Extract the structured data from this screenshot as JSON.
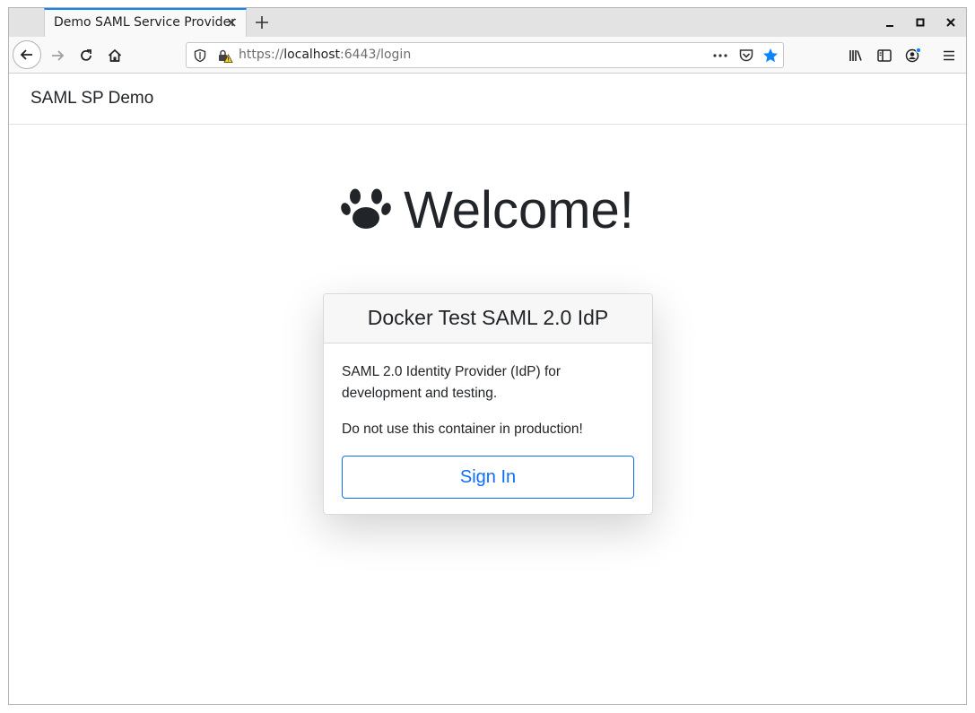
{
  "browser": {
    "tab_title": "Demo SAML Service Provider",
    "url_prefix": "https://",
    "url_host": "localhost",
    "url_rest": ":6443/login",
    "accent_color": "#0a84ff"
  },
  "site": {
    "brand": "SAML SP Demo",
    "heading": "Welcome!",
    "heading_icon": "paw-icon"
  },
  "card": {
    "title": "Docker Test SAML 2.0 IdP",
    "description": "SAML 2.0 Identity Provider (IdP) for development and testing.",
    "warning": "Do not use this container in production!",
    "button_label": "Sign In",
    "button_color": "#0d6efd"
  }
}
